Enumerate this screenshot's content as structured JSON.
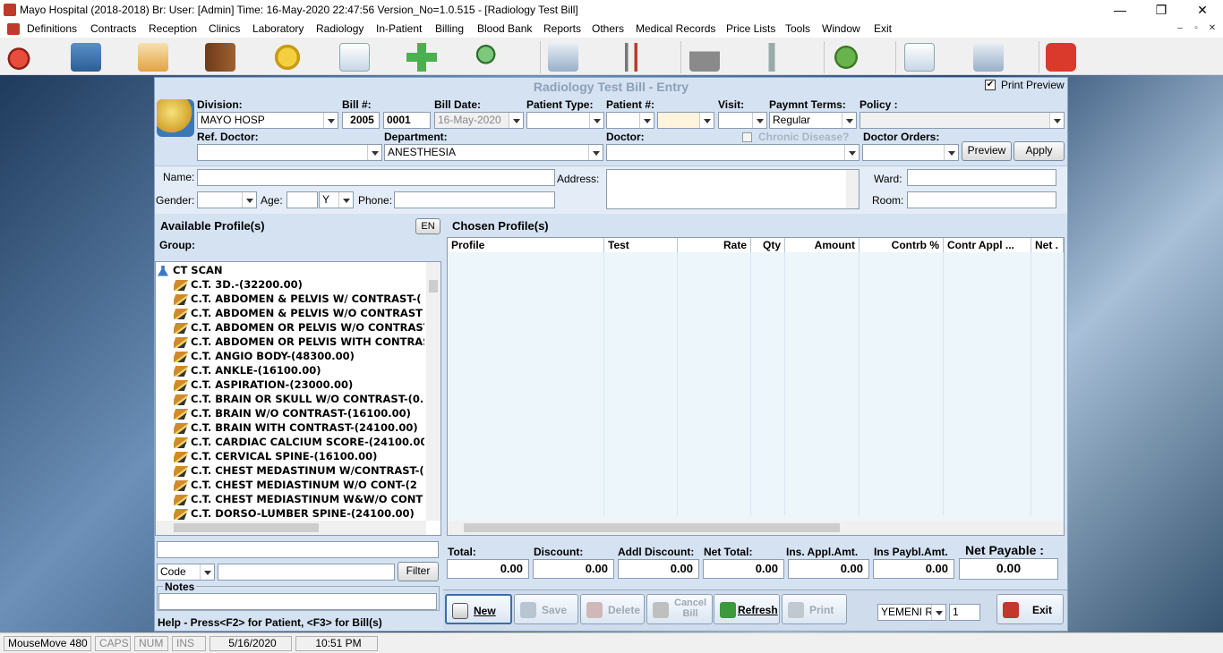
{
  "window": {
    "title": "Mayo Hospital (2018-2018) Br: User: [Admin] Time: 16-May-2020 22:47:56     Version_No=1.0.515 - [Radiology Test Bill]",
    "minimize": "—",
    "restore": "❐",
    "close": "✕"
  },
  "menu": [
    "Definitions",
    "Contracts",
    "Reception",
    "Clinics",
    "Laboratory",
    "Radiology",
    "In-Patient",
    "Billing",
    "Blood Bank",
    "Reports",
    "Others",
    "Medical Records",
    "Price Lists",
    "Tools",
    "Window",
    "Exit"
  ],
  "mdi": {
    "min": "–",
    "restore": "▫",
    "close": "✕"
  },
  "toolbar": [
    "phone-icon",
    "doctor-icon",
    "certificate-icon",
    "door-icon",
    "coins-icon",
    "checklist-icon",
    "add-icon",
    "search-person-icon",
    "dollar-doc-icon",
    "instruments-icon",
    "factory-icon",
    "pipe-icon",
    "money-hand-icon",
    "checklist-red-icon",
    "dollar-doc2-icon",
    "power-icon"
  ],
  "form": {
    "title": "Radiology Test Bill - Entry",
    "print_preview_label": "Print Preview",
    "print_preview_checked": true,
    "division_label": "Division:",
    "division_value": "MAYO HOSP",
    "bill_label": "Bill #:",
    "bill_year": "2005",
    "bill_no": "0001",
    "bill_date_label": "Bill Date:",
    "bill_date_value": "16-May-2020",
    "patient_type_label": "Patient Type:",
    "patient_no_label": "Patient #:",
    "visit_label": "Visit:",
    "payment_terms_label": "Paymnt Terms:",
    "payment_terms_value": "Regular",
    "policy_label": "Policy :",
    "ref_doctor_label": "Ref. Doctor:",
    "department_label": "Department:",
    "department_value": "ANESTHESIA",
    "doctor_label": "Doctor:",
    "chronic_label": "Chronic Disease?",
    "doctor_orders_label": "Doctor Orders:",
    "preview_button": "Preview",
    "apply_button": "Apply",
    "name_label": "Name:",
    "address_label": "Address:",
    "ward_label": "Ward:",
    "gender_label": "Gender:",
    "age_label": "Age:",
    "age_unit": "Y",
    "phone_label": "Phone:",
    "room_label": "Room:"
  },
  "available": {
    "title": "Available Profile(s)",
    "lang_button": "EN",
    "group_label": "Group:",
    "group_name": "CT SCAN",
    "items": [
      "C.T. 3D.-(32200.00)",
      "C.T. ABDOMEN & PELVIS W/ CONTRAST-(",
      "C.T. ABDOMEN & PELVIS W/O CONTRAST",
      "C.T. ABDOMEN OR PELVIS W/O CONTRAST",
      "C.T. ABDOMEN OR PELVIS WITH CONTRAS",
      "C.T. ANGIO BODY-(48300.00)",
      "C.T. ANKLE-(16100.00)",
      "C.T. ASPIRATION-(23000.00)",
      "C.T. BRAIN OR SKULL W/O CONTRAST-(0.",
      "C.T. BRAIN W/O CONTRAST-(16100.00)",
      "C.T. BRAIN WITH CONTRAST-(24100.00)",
      "C.T. CARDIAC CALCIUM SCORE-(24100.00",
      "C.T. CERVICAL SPINE-(16100.00)",
      "C.T. CHEST MEDASTINUM W/CONTRAST-(",
      "C.T. CHEST MEDIASTINUM  W/O CONT-(2",
      "C.T. CHEST MEDIASTINUM W&W/O CONT",
      "C.T. DORSO-LUMBER SPINE-(24100.00)"
    ],
    "search_by": "Code",
    "filter_button": "Filter",
    "notes_label": "Notes",
    "help_text": "Help - Press<F2> for Patient, <F3> for Bill(s)"
  },
  "chosen": {
    "title": "Chosen Profile(s)",
    "columns": [
      "Profile",
      "Test",
      "Rate",
      "Qty",
      "Amount",
      "Contrb %",
      "Contr Appl ...",
      "Net ."
    ]
  },
  "totals": {
    "total_label": "Total:",
    "total": "0.00",
    "discount_label": "Discount:",
    "discount": "0.00",
    "addl_discount_label": "Addl Discount:",
    "addl_discount": "0.00",
    "net_total_label": "Net Total:",
    "net_total": "0.00",
    "ins_appl_label": "Ins. Appl.Amt.",
    "ins_appl": "0.00",
    "ins_paybl_label": "Ins Paybl.Amt.",
    "ins_paybl": "0.00",
    "net_payable_label": "Net Payable :",
    "net_payable": "0.00"
  },
  "actions": {
    "new": "New",
    "save": "Save",
    "delete": "Delete",
    "cancel_bill": "Cancel Bill",
    "refresh": "Refresh",
    "print": "Print",
    "exit": "Exit",
    "currency": "YEMENI R",
    "copies": "1"
  },
  "status": {
    "mousemove": "MouseMove 480",
    "caps": "CAPS",
    "num": "NUM",
    "ins": "INS",
    "date": "5/16/2020",
    "time": "10:51 PM"
  },
  "colors": {
    "form_bg": "#d4e2f2",
    "grid_bg": "#edf6fb",
    "accent_blue": "#3a78c8"
  }
}
